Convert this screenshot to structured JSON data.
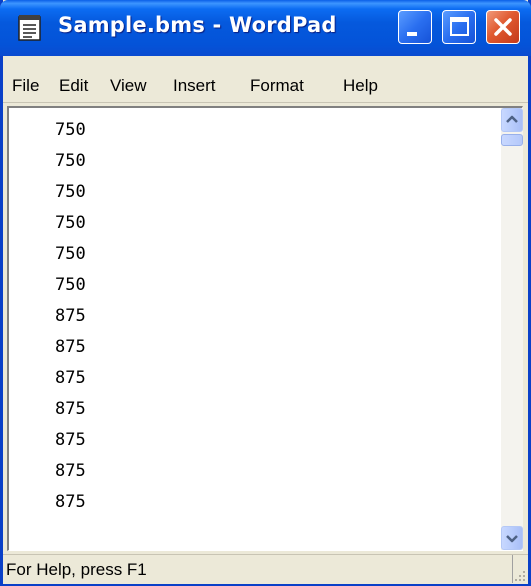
{
  "window": {
    "title": "Sample.bms - WordPad",
    "icon": "notepad-document-icon"
  },
  "titlebar_buttons": {
    "minimize_icon": "minimize-icon",
    "maximize_icon": "maximize-icon",
    "close_icon": "close-icon"
  },
  "menu": {
    "items": [
      {
        "label": "File"
      },
      {
        "label": "Edit"
      },
      {
        "label": "View"
      },
      {
        "label": "Insert"
      },
      {
        "label": "Format"
      },
      {
        "label": "Help"
      }
    ]
  },
  "document": {
    "lines": [
      "750",
      "750",
      "750",
      "750",
      "750",
      "750",
      "875",
      "875",
      "875",
      "875",
      "875",
      "875",
      "875"
    ]
  },
  "scrollbar": {
    "up_icon": "chevron-up-icon",
    "down_icon": "chevron-down-icon"
  },
  "status": {
    "text": "For Help, press F1",
    "grip_icon": "resize-grip-icon"
  },
  "colors": {
    "titlebar": "#0559dd",
    "close_button": "#e05a30",
    "chrome": "#ece9d8",
    "scrollbar_button": "#b8ccfc"
  }
}
